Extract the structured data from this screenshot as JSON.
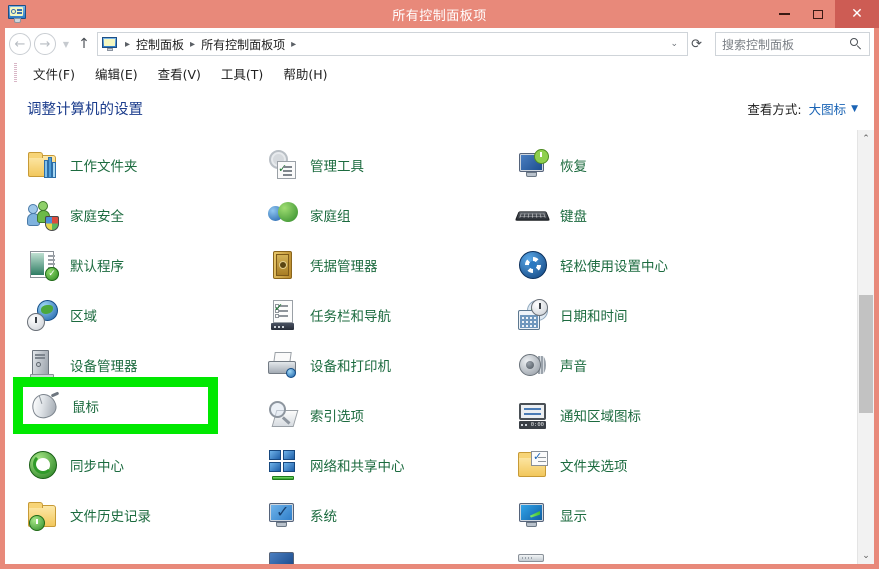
{
  "window": {
    "title": "所有控制面板项",
    "app_icon": "control-panel-icon",
    "accent_color": "#e8897a",
    "close_button_color": "#cd5c54",
    "buttons": {
      "minimize": "minimize-icon",
      "maximize": "maximize-icon",
      "close": "✕"
    }
  },
  "navbar": {
    "back": "back-arrow-icon",
    "forward": "forward-arrow-icon",
    "recent": "chevron-down-icon",
    "up": "up-arrow-icon",
    "breadcrumbs": [
      "控制面板",
      "所有控制面板项"
    ],
    "separator": "▸",
    "history_chevron": "⌄",
    "refresh": "refresh-icon"
  },
  "search": {
    "placeholder": "搜索控制面板",
    "icon": "search-icon"
  },
  "menubar": {
    "items": [
      "文件(F)",
      "编辑(E)",
      "查看(V)",
      "工具(T)",
      "帮助(H)"
    ]
  },
  "header": {
    "title": "调整计算机的设置",
    "title_color": "#1b3c8c",
    "viewby_label": "查看方式:",
    "viewby_value": "大图标",
    "viewby_caret": "▼"
  },
  "grid": {
    "label_color": "#1c6b3f",
    "columns": 3,
    "items": [
      {
        "label": "工作文件夹",
        "icon": "work-folders-icon",
        "col": 1,
        "row": 1
      },
      {
        "label": "管理工具",
        "icon": "administrative-tools-icon",
        "col": 2,
        "row": 1
      },
      {
        "label": "恢复",
        "icon": "recovery-icon",
        "col": 3,
        "row": 1
      },
      {
        "label": "家庭安全",
        "icon": "family-safety-icon",
        "col": 1,
        "row": 2
      },
      {
        "label": "家庭组",
        "icon": "homegroup-icon",
        "col": 2,
        "row": 2
      },
      {
        "label": "键盘",
        "icon": "keyboard-icon",
        "col": 3,
        "row": 2
      },
      {
        "label": "默认程序",
        "icon": "default-programs-icon",
        "col": 1,
        "row": 3
      },
      {
        "label": "凭据管理器",
        "icon": "credential-manager-icon",
        "col": 2,
        "row": 3
      },
      {
        "label": "轻松使用设置中心",
        "icon": "ease-of-access-icon",
        "col": 3,
        "row": 3
      },
      {
        "label": "区域",
        "icon": "region-icon",
        "col": 1,
        "row": 4
      },
      {
        "label": "任务栏和导航",
        "icon": "taskbar-navigation-icon",
        "col": 2,
        "row": 4
      },
      {
        "label": "日期和时间",
        "icon": "date-time-icon",
        "col": 3,
        "row": 4
      },
      {
        "label": "设备管理器",
        "icon": "device-manager-icon",
        "col": 1,
        "row": 5
      },
      {
        "label": "设备和打印机",
        "icon": "devices-printers-icon",
        "col": 2,
        "row": 5
      },
      {
        "label": "声音",
        "icon": "sound-icon",
        "col": 3,
        "row": 5
      },
      {
        "label": "鼠标",
        "icon": "mouse-icon",
        "col": 1,
        "row": 6
      },
      {
        "label": "索引选项",
        "icon": "indexing-options-icon",
        "col": 2,
        "row": 6
      },
      {
        "label": "通知区域图标",
        "icon": "notification-area-icon",
        "col": 3,
        "row": 6
      },
      {
        "label": "同步中心",
        "icon": "sync-center-icon",
        "col": 1,
        "row": 7
      },
      {
        "label": "网络和共享中心",
        "icon": "network-sharing-icon",
        "col": 2,
        "row": 7
      },
      {
        "label": "文件夹选项",
        "icon": "folder-options-icon",
        "col": 3,
        "row": 7
      },
      {
        "label": "文件历史记录",
        "icon": "file-history-icon",
        "col": 1,
        "row": 8
      },
      {
        "label": "系统",
        "icon": "system-icon",
        "col": 2,
        "row": 8
      },
      {
        "label": "显示",
        "icon": "display-icon",
        "col": 3,
        "row": 8
      }
    ]
  },
  "highlight": {
    "target_label": "鼠标",
    "target_icon": "mouse-icon",
    "border_color": "#00e800"
  },
  "scrollbar": {
    "up_arrow": "⌃",
    "down_arrow": "⌄",
    "thumb": "scrollbar-thumb"
  },
  "notif_tray_text": "0:00"
}
